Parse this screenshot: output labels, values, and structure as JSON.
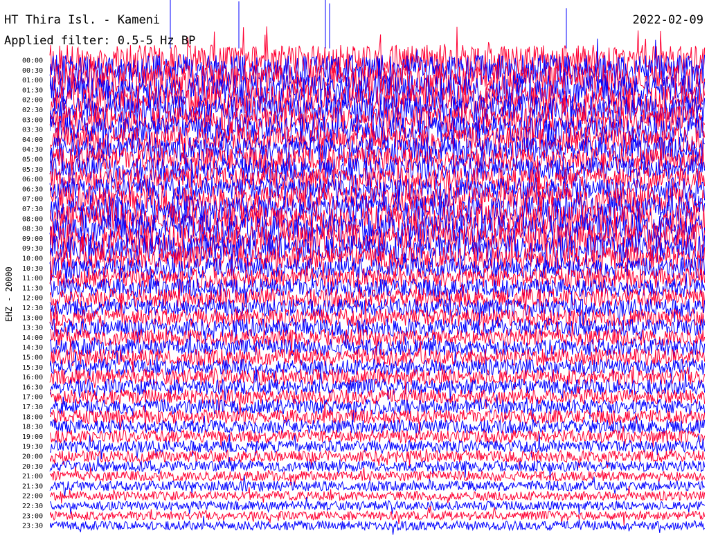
{
  "chart_data": {
    "type": "line",
    "title": "HT Thira Isl. - Kameni",
    "date": "2022-02-09",
    "filter_label": "Applied filter: 0.5-5 Hz BP",
    "channel_label": "EHZ - 20000",
    "ylabel": "EHZ - 20000",
    "xlabel": "",
    "row_labels": [
      "00:00",
      "00:30",
      "01:00",
      "01:30",
      "02:00",
      "02:30",
      "03:00",
      "03:30",
      "04:00",
      "04:30",
      "05:00",
      "05:30",
      "06:00",
      "06:30",
      "07:00",
      "07:30",
      "08:00",
      "08:30",
      "09:00",
      "09:30",
      "10:00",
      "10:30",
      "11:00",
      "11:30",
      "12:00",
      "12:30",
      "13:00",
      "13:30",
      "14:00",
      "14:30",
      "15:00",
      "15:30",
      "16:00",
      "16:30",
      "17:00",
      "17:30",
      "18:00",
      "18:30",
      "19:00",
      "19:30",
      "20:00",
      "20:30",
      "21:00",
      "21:30",
      "22:00",
      "22:30",
      "23:00",
      "23:30"
    ],
    "series": [
      {
        "color": "#ff0033"
      },
      {
        "color": "#0000ff"
      }
    ],
    "amplitude_profile": [
      1.55,
      1.55,
      1.55,
      1.5,
      1.45,
      1.4,
      1.35,
      1.35,
      1.3,
      1.25,
      1.2,
      1.2,
      1.15,
      1.15,
      1.3,
      1.35,
      1.4,
      1.45,
      1.45,
      1.4,
      1.2,
      1.05,
      1.0,
      0.95,
      0.95,
      0.9,
      0.9,
      0.9,
      0.85,
      0.85,
      0.85,
      0.8,
      0.8,
      0.8,
      0.75,
      0.75,
      0.7,
      0.7,
      0.65,
      0.6,
      0.6,
      0.55,
      0.5,
      0.5,
      0.45,
      0.45,
      0.45,
      0.45
    ],
    "grid": false,
    "legend": "none"
  }
}
